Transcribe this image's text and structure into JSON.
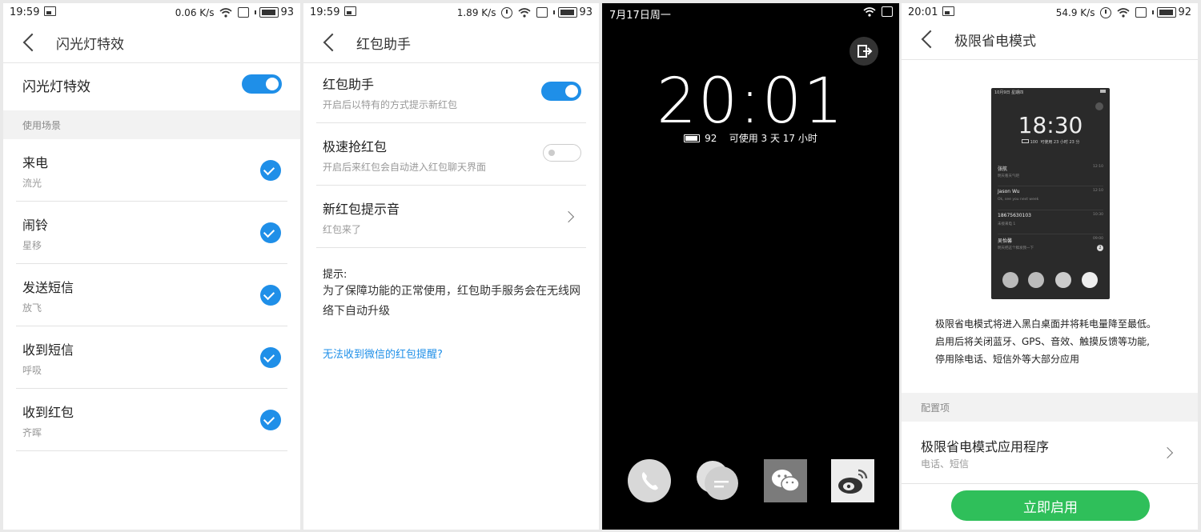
{
  "screen1": {
    "status": {
      "time": "19:59",
      "speed": "0.06",
      "speed_unit": "K/s",
      "battery": "93"
    },
    "header": {
      "title": "闪光灯特效"
    },
    "master_toggle": {
      "label": "闪光灯特效",
      "on": true
    },
    "section": "使用场景",
    "items": [
      {
        "title": "来电",
        "subtitle": "流光",
        "checked": true
      },
      {
        "title": "闹铃",
        "subtitle": "星移",
        "checked": true
      },
      {
        "title": "发送短信",
        "subtitle": "放飞",
        "checked": true
      },
      {
        "title": "收到短信",
        "subtitle": "呼吸",
        "checked": true
      },
      {
        "title": "收到红包",
        "subtitle": "齐晖",
        "checked": true
      }
    ]
  },
  "screen2": {
    "status": {
      "time": "19:59",
      "speed": "1.89",
      "speed_unit": "K/s",
      "battery": "93"
    },
    "header": {
      "title": "红包助手"
    },
    "rows": [
      {
        "title": "红包助手",
        "subtitle": "开启后以特有的方式提示新红包",
        "control": "toggle",
        "on": true
      },
      {
        "title": "极速抢红包",
        "subtitle": "开启后来红包会自动进入红包聊天界面",
        "control": "toggle",
        "on": false
      },
      {
        "title": "新红包提示音",
        "subtitle": "红包来了",
        "control": "chevron"
      }
    ],
    "tip_title": "提示:",
    "tip_body": "为了保障功能的正常使用，红包助手服务会在无线网络下自动升级",
    "link": "无法收到微信的红包提醒?"
  },
  "screen3": {
    "date": "7月17日周一",
    "clock": "20:01",
    "battery": "92",
    "usage": "可使用 3 天 17 小时",
    "dock": [
      {
        "name": "phone-icon"
      },
      {
        "name": "messages-icon"
      },
      {
        "name": "wechat-icon"
      },
      {
        "name": "weibo-icon"
      }
    ]
  },
  "screen4": {
    "status": {
      "time": "20:01",
      "speed": "54.9",
      "speed_unit": "K/s",
      "battery": "92"
    },
    "header": {
      "title": "极限省电模式"
    },
    "preview": {
      "date": "10月9日 星期四",
      "clock": "18:30",
      "battery": "100",
      "usage": "可使用 23 小时 23 分",
      "notifications": [
        {
          "name": "张航",
          "msg": "明天看天气吧",
          "time": "12:10"
        },
        {
          "name": "Jason Wu",
          "msg": "Ok, see you next week",
          "time": "12:10"
        },
        {
          "name": "18675630103",
          "msg": "未接来电 1",
          "time": "10:30"
        },
        {
          "name": "吴怡馨",
          "msg": "明天把这个稿发我一下",
          "time": "09:00",
          "badge": "2"
        }
      ]
    },
    "description": [
      "极限省电模式将进入黑白桌面并将耗电量降至最低。",
      "启用后将关闭蓝牙、GPS、音效、触摸反馈等功能,",
      "停用除电话、短信外等大部分应用"
    ],
    "section": "配置项",
    "config_row": {
      "title": "极限省电模式应用程序",
      "subtitle": "电话、短信"
    },
    "button": "立即启用"
  }
}
